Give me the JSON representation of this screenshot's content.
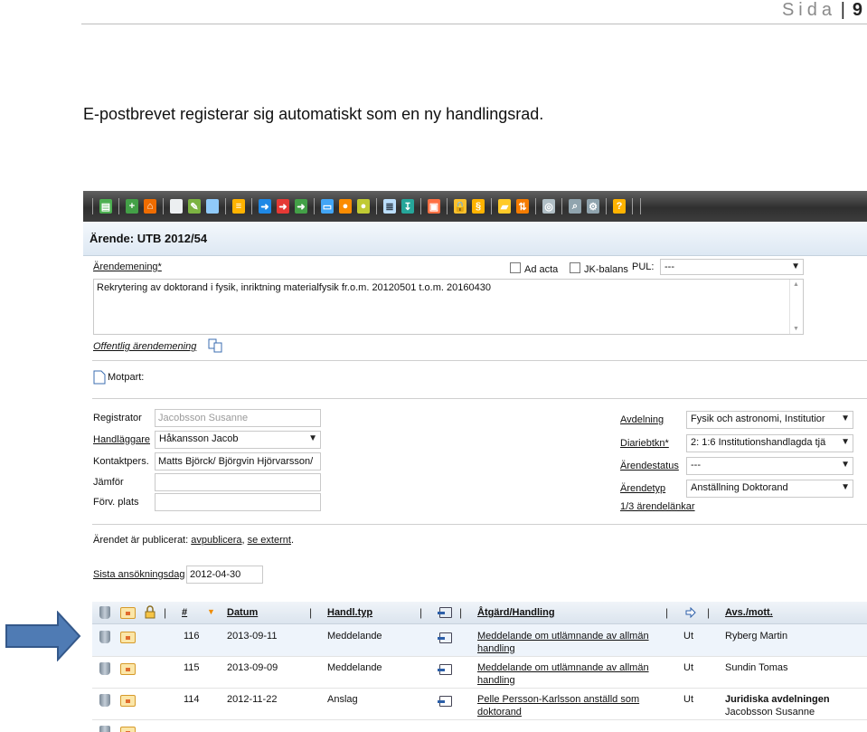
{
  "page_header": {
    "sida": "Sida",
    "sep": "|",
    "number": "9"
  },
  "caption": "E-postbrevet registerar sig automatiskt som en ny handlingsrad.",
  "app": {
    "toolbar_icons": [
      {
        "name": "save-icon",
        "color": "#4caf50",
        "glyph": "▤"
      },
      {
        "name": "add-icon",
        "color": "#43a047",
        "glyph": "+"
      },
      {
        "name": "home-icon",
        "color": "#ef6c00",
        "glyph": "⌂"
      },
      {
        "name": "new-document-icon",
        "color": "#eceff1",
        "glyph": ""
      },
      {
        "name": "edit-document-icon",
        "color": "#7cb342",
        "glyph": "✎"
      },
      {
        "name": "document-icon",
        "color": "#90caf9",
        "glyph": ""
      },
      {
        "name": "list-icon",
        "color": "#ffb300",
        "glyph": "≡"
      },
      {
        "name": "arrow-right-blue-icon",
        "color": "#1e88e5",
        "glyph": "➜"
      },
      {
        "name": "arrow-right-red-icon",
        "color": "#e53935",
        "glyph": "➜"
      },
      {
        "name": "arrow-right-green-icon",
        "color": "#43a047",
        "glyph": "➜"
      },
      {
        "name": "card-icon",
        "color": "#42a5f5",
        "glyph": "▭"
      },
      {
        "name": "person-icon",
        "color": "#fb8c00",
        "glyph": "●"
      },
      {
        "name": "people-icon",
        "color": "#c0ca33",
        "glyph": "●"
      },
      {
        "name": "table-icon",
        "color": "#bbdefb",
        "glyph": "≣"
      },
      {
        "name": "export-icon",
        "color": "#26a69a",
        "glyph": "↧"
      },
      {
        "name": "window-icon",
        "color": "#ff7043",
        "glyph": "▣"
      },
      {
        "name": "lock-icon",
        "color": "#fbc02d",
        "glyph": "🔒"
      },
      {
        "name": "paragraph-icon",
        "color": "#ffb300",
        "glyph": "§"
      },
      {
        "name": "folder-icon",
        "color": "#ffca28",
        "glyph": "▰"
      },
      {
        "name": "sort-icon",
        "color": "#f57c00",
        "glyph": "⇅"
      },
      {
        "name": "binoculars-icon",
        "color": "#b0bec5",
        "glyph": "◎"
      },
      {
        "name": "magnifier-icon",
        "color": "#90a4ae",
        "glyph": "⌕"
      },
      {
        "name": "settings-icon",
        "color": "#90a4ae",
        "glyph": "⚙"
      },
      {
        "name": "help-icon",
        "color": "#ffb300",
        "glyph": "?"
      }
    ],
    "title": "Ärende: UTB 2012/54",
    "arendemening_label": "Ärendemening*",
    "ad_acta_label": "Ad acta",
    "jk_balans_label": "JK-balans",
    "pul_label": "PUL:",
    "pul_value": "---",
    "arendemening_text": "Rekrytering av doktorand i fysik, inriktning materialfysik fr.o.m. 20120501 t.o.m. 20160430",
    "offentlig_label": "Offentlig ärendemening",
    "motpart_label": "Motpart:",
    "left_fields": {
      "registrator_label": "Registrator",
      "registrator_value": "Jacobsson Susanne",
      "handlaggare_label": "Handläggare",
      "handlaggare_value": "Håkansson Jacob",
      "kontaktpers_label": "Kontaktpers.",
      "kontaktpers_value": "Matts Björck/ Björgvin Hjörvarsson/",
      "jamfor_label": "Jämför",
      "jamfor_value": "",
      "forv_label": "Förv. plats",
      "forv_value": ""
    },
    "right_fields": {
      "avdelning_label": "Avdelning",
      "avdelning_value": "Fysik och astronomi, Institutior",
      "diariebtkn_label": "Diariebtkn*",
      "diariebtkn_value": "2: 1:6 Institutionshandlagda tjä",
      "arendestatus_label": "Ärendestatus",
      "arendestatus_value": "---",
      "arendetyp_label": "Ärendetyp",
      "arendetyp_value": "Anställning Doktorand",
      "arendelankar": "1/3 ärendelänkar"
    },
    "publicerat": {
      "prefix": "Ärendet är publicerat:",
      "avpublicera": "avpublicera",
      "comma": ",",
      "se_externt": "se externt",
      "suffix": "."
    },
    "sista_label": "Sista ansökningsdag",
    "sista_value": "2012-04-30",
    "grid": {
      "headers": {
        "num": "#",
        "datum": "Datum",
        "handl_typ": "Handl.typ",
        "atgard": "Åtgärd/Handling",
        "avs": "Avs./mott."
      },
      "rows": [
        {
          "num": "116",
          "datum": "2013-09-11",
          "typ": "Meddelande",
          "atgard": "Meddelande om utlämnande av allmän handling",
          "riktning": "Ut",
          "avs": "Ryberg Martin",
          "avs2": "",
          "bold": false
        },
        {
          "num": "115",
          "datum": "2013-09-09",
          "typ": "Meddelande",
          "atgard": "Meddelande om utlämnande av allmän handling",
          "riktning": "Ut",
          "avs": "Sundin Tomas",
          "avs2": "",
          "bold": false
        },
        {
          "num": "114",
          "datum": "2012-11-22",
          "typ": "Anslag",
          "atgard": "Pelle Persson-Karlsson anställd som doktorand",
          "riktning": "Ut",
          "avs": "Juridiska avdelningen",
          "avs2": "Jacobsson Susanne",
          "bold": true
        }
      ]
    }
  },
  "colors": {
    "arrow": "#4f7bb4",
    "arrow_border": "#34588a",
    "title_bg": "#e6eef7"
  }
}
